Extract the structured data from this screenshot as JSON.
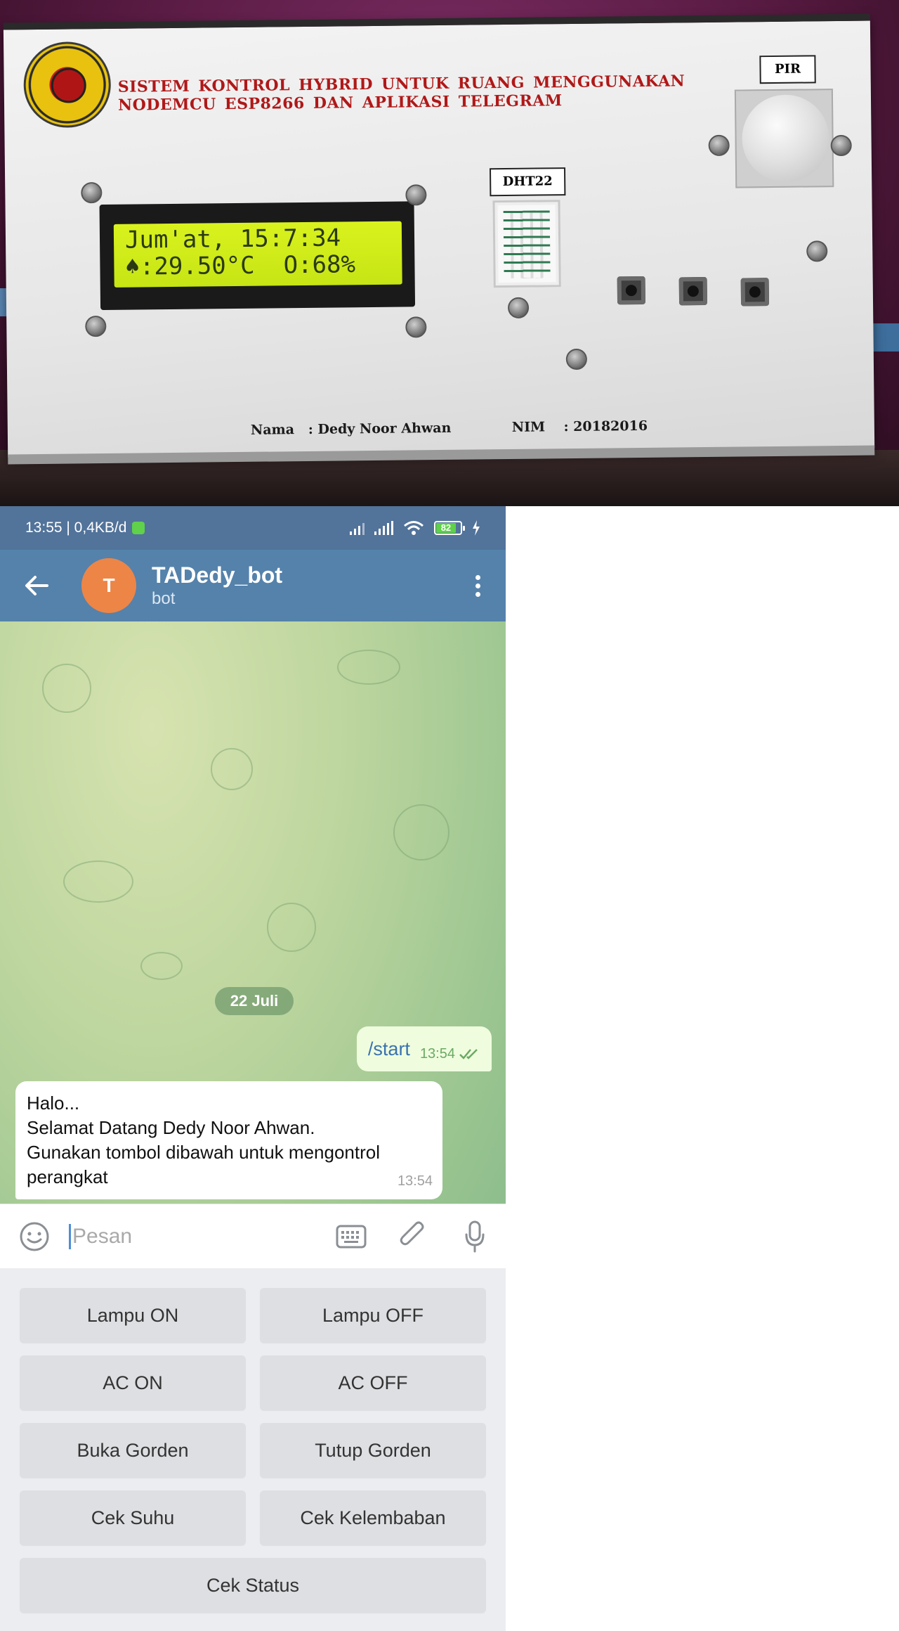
{
  "photo": {
    "title_line1": "SISTEM  KONTROL  HYBRID  UNTUK RUANG  MENGGUNAKAN",
    "title_line2": "NODEMCU ESP8266 DAN APLIKASI TELEGRAM",
    "pir_label": "PIR",
    "dht_label": "DHT22",
    "lcd_line1": "Jum'at, 15:7:34",
    "lcd_line2": "♠:29.50°C  O:68%",
    "nama": "Nama   : Dedy Noor Ahwan",
    "nim": "NIM    : 20182016"
  },
  "statusbar": {
    "time_speed": "13:55 | 0,4KB/d",
    "battery": "82"
  },
  "chat_header": {
    "avatar_letter": "T",
    "title": "TADedy_bot",
    "subtitle": "bot"
  },
  "chat": {
    "date": "22 Juli",
    "outgoing": {
      "text": "/start",
      "time": "13:54"
    },
    "incoming": {
      "lines": [
        "Halo...",
        "Selamat Datang Dedy Noor Ahwan.",
        "Gunakan tombol dibawah untuk mengontrol",
        "perangkat"
      ],
      "time": "13:54"
    }
  },
  "composer": {
    "placeholder": "Pesan"
  },
  "keyboard": {
    "buttons": [
      "Lampu ON",
      "Lampu OFF",
      "AC ON",
      "AC OFF",
      "Buka Gorden",
      "Tutup Gorden",
      "Cek Suhu",
      "Cek Kelembaban",
      "Cek Status"
    ]
  },
  "colors": {
    "header": "#5482ab",
    "statusbar": "#52739a",
    "avatar": "#ed8547",
    "outgoing_bubble": "#effdde",
    "link": "#3a72b0"
  }
}
